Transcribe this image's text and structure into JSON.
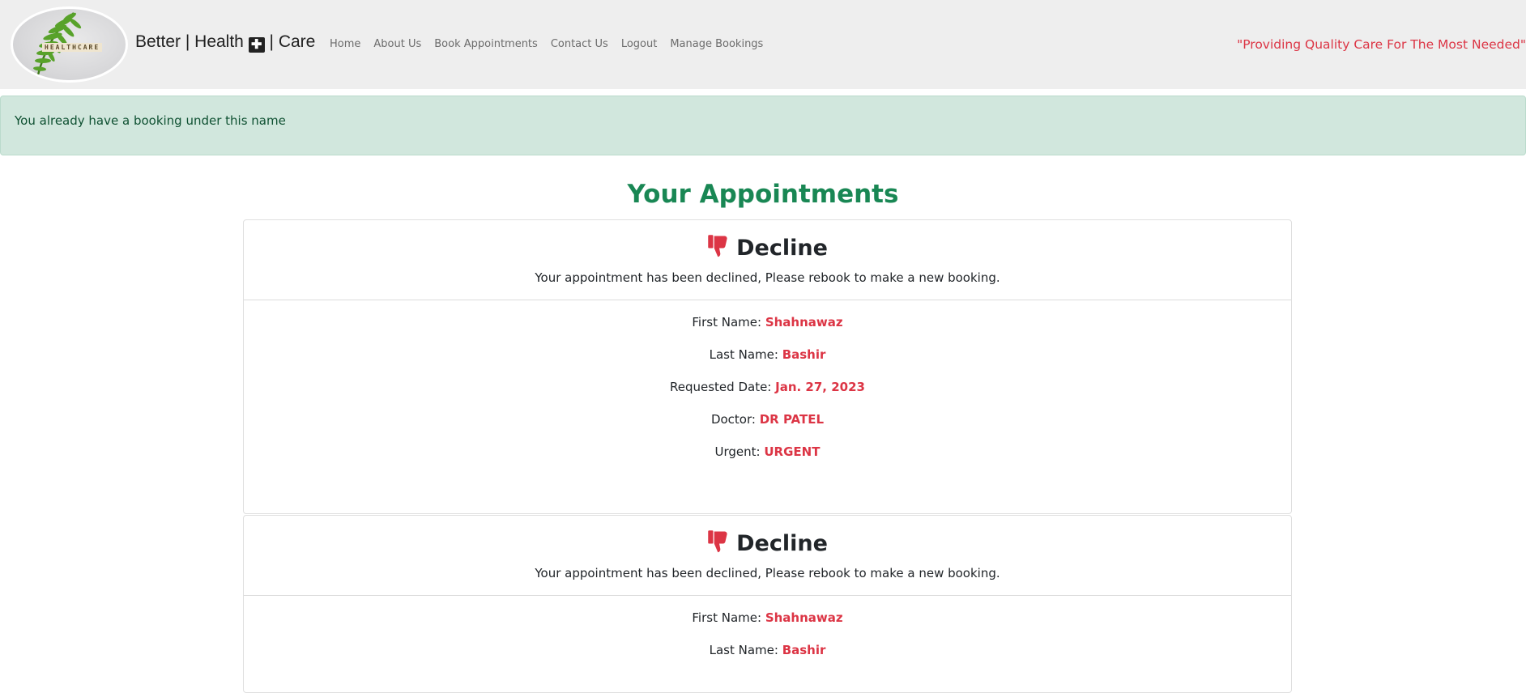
{
  "brand": {
    "logo_text": "HEALTHCARE",
    "name_part1": "Better | Health ",
    "mark": "✚",
    "name_part2": " | Care"
  },
  "nav": {
    "items": [
      {
        "label": "Home"
      },
      {
        "label": "About Us"
      },
      {
        "label": "Book Appointments"
      },
      {
        "label": "Contact Us"
      },
      {
        "label": "Logout"
      },
      {
        "label": "Manage Bookings"
      }
    ]
  },
  "tagline": "\"Providing Quality Care For The Most Needed\"",
  "alert": {
    "message": "You already have a booking under this name"
  },
  "page_title": "Your Appointments",
  "colors": {
    "accent_green": "#198754",
    "danger_red": "#dc3545",
    "alert_bg": "#d1e7dd",
    "navbar_bg": "#eeeeee"
  },
  "appointments": [
    {
      "status_icon": "thumbs-down-icon",
      "status": "Decline",
      "message": "Your appointment has been declined, Please rebook to make a new booking.",
      "fields": [
        {
          "label": "First Name: ",
          "value": "Shahnawaz"
        },
        {
          "label": "Last Name: ",
          "value": "Bashir"
        },
        {
          "label": "Requested Date: ",
          "value": "Jan. 27, 2023"
        },
        {
          "label": "Doctor: ",
          "value": "DR PATEL"
        },
        {
          "label": "Urgent: ",
          "value": "URGENT"
        }
      ]
    },
    {
      "status_icon": "thumbs-down-icon",
      "status": "Decline",
      "message": "Your appointment has been declined, Please rebook to make a new booking.",
      "fields": [
        {
          "label": "First Name: ",
          "value": "Shahnawaz"
        },
        {
          "label": "Last Name: ",
          "value": "Bashir"
        }
      ]
    }
  ]
}
